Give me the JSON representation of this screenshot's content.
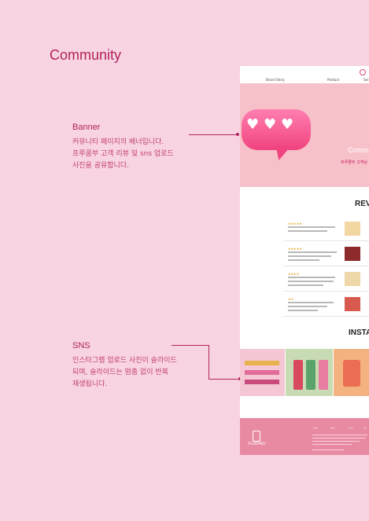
{
  "page": {
    "title": "Community"
  },
  "annotations": {
    "banner": {
      "title": "Banner",
      "description": "커뮤니티 페이지의 배너입니다.\n프루쿰부 고객 리뷰 및 sns 업로드\n사진을 공유합니다."
    },
    "sns": {
      "title": "SNS",
      "description": "인스타그램 업로드 사진이 슬라이드\n되며, 슬라이드는 멈춤 없이 반복\n재생됩니다."
    }
  },
  "mockup": {
    "nav": [
      "Brand Story",
      "Product",
      "Ser"
    ],
    "banner_heading": "Comm",
    "banner_text": "프루쿰부 고객님",
    "reviews_heading": "REV",
    "insta_heading": "INSTA",
    "footer_brand": "FRUKOMBU"
  },
  "colors": {
    "accent": "#b0245d",
    "background": "#f8d3e2",
    "footer": "#e98aa3"
  }
}
